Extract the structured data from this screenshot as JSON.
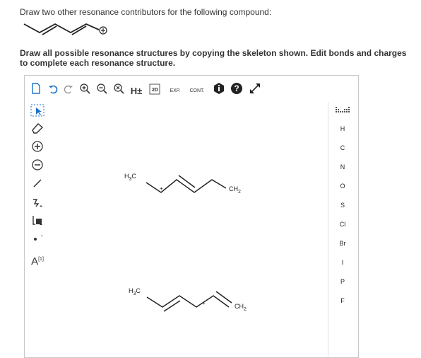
{
  "question": {
    "prompt": "Draw two other resonance contributors for the following compound:",
    "instruction": "Draw all possible resonance structures by copying the skeleton shown. Edit bonds and charges to complete each resonance structure."
  },
  "toolbar": {
    "h_label": "H±",
    "label_2d": "2D",
    "exp_label": "EXP.",
    "cont_label": "CONT."
  },
  "left_tools": {
    "atom_label": "A",
    "atom_sup": "[1]"
  },
  "elements": [
    "H",
    "C",
    "N",
    "O",
    "S",
    "Cl",
    "Br",
    "I",
    "P",
    "F"
  ],
  "structures": {
    "s1": {
      "left": "H",
      "left_sub": "3",
      "left_main": "C",
      "right": "CH",
      "right_sub": "2",
      "charge": "+"
    },
    "s2": {
      "left": "H",
      "left_sub": "3",
      "left_main": "C",
      "right": "CH",
      "right_sub": "2",
      "charge": "+"
    }
  },
  "colors": {
    "accent": "#1a73c8",
    "dark": "#222222"
  }
}
